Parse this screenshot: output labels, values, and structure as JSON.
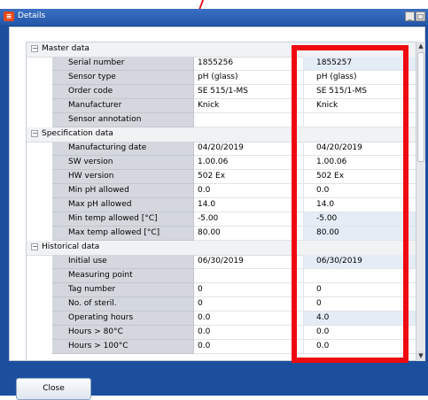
{
  "window": {
    "title": "Details",
    "minimize_glyph": "_",
    "maximize_glyph": "□"
  },
  "scrollbar": {
    "up_glyph": "▲",
    "down_glyph": "▼"
  },
  "close_label": "Close",
  "sections": [
    {
      "title": "Master data",
      "toggle": "⊟",
      "rows": [
        {
          "label": "Serial number",
          "value1": "1855256",
          "value2": "1855257",
          "highlight": true
        },
        {
          "label": "Sensor type",
          "value1": "pH (glass)",
          "value2": "pH (glass)",
          "highlight": false
        },
        {
          "label": "Order code",
          "value1": "SE 515/1-MS",
          "value2": "SE 515/1-MS",
          "highlight": false
        },
        {
          "label": "Manufacturer",
          "value1": "Knick",
          "value2": "Knick",
          "highlight": false
        },
        {
          "label": "Sensor annotation",
          "value1": "",
          "value2": "",
          "highlight": false
        }
      ]
    },
    {
      "title": "Specification data",
      "toggle": "⊟",
      "rows": [
        {
          "label": "Manufacturing date",
          "value1": "04/20/2019",
          "value2": "04/20/2019",
          "highlight": false
        },
        {
          "label": "SW version",
          "value1": "1.00.06",
          "value2": "1.00.06",
          "highlight": false
        },
        {
          "label": "HW version",
          "value1": "502 Ex",
          "value2": "502 Ex",
          "highlight": false
        },
        {
          "label": "Min pH allowed",
          "value1": "0.0",
          "value2": "0.0",
          "highlight": false
        },
        {
          "label": "Max pH allowed",
          "value1": "14.0",
          "value2": "14.0",
          "highlight": false
        },
        {
          "label": "Min temp allowed [°C]",
          "value1": "-5.00",
          "value2": "-5.00",
          "highlight": true
        },
        {
          "label": "Max temp allowed [°C]",
          "value1": "80.00",
          "value2": "80.00",
          "highlight": true
        }
      ]
    },
    {
      "title": "Historical data",
      "toggle": "⊟",
      "rows": [
        {
          "label": "Initial use",
          "value1": "06/30/2019",
          "value2": "06/30/2019",
          "highlight": true
        },
        {
          "label": "Measuring point",
          "value1": "",
          "value2": "",
          "highlight": false
        },
        {
          "label": "Tag number",
          "value1": "0",
          "value2": "0",
          "highlight": false
        },
        {
          "label": "No. of steril.",
          "value1": "0",
          "value2": "0",
          "highlight": false
        },
        {
          "label": "Operating hours",
          "value1": "0.0",
          "value2": "4.0",
          "highlight": true
        },
        {
          "label": "Hours > 80°C",
          "value1": "0.0",
          "value2": "0.0",
          "highlight": false
        },
        {
          "label": "Hours > 100°C",
          "value1": "0.0",
          "value2": "0.0",
          "highlight": false
        }
      ]
    }
  ]
}
